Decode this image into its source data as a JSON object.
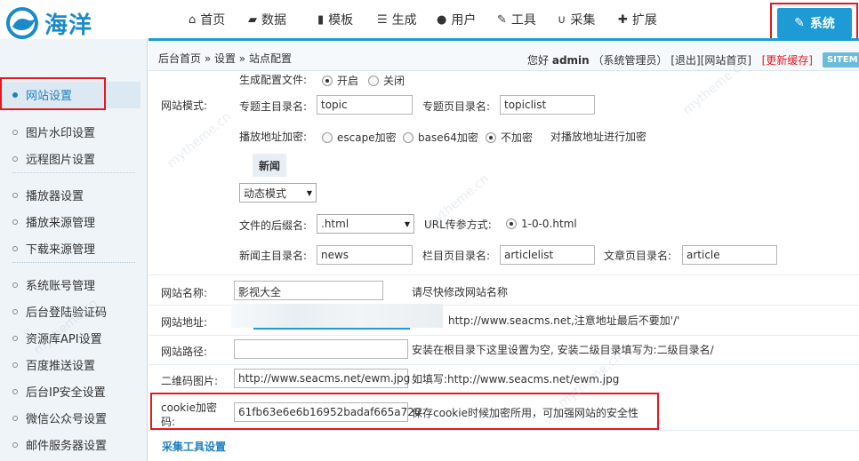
{
  "brand": {
    "name": "海洋"
  },
  "nav": {
    "items": [
      {
        "label": "首页",
        "icon": "home-icon",
        "glyph": "⌂"
      },
      {
        "label": "数据",
        "icon": "book-icon",
        "glyph": "▰"
      },
      {
        "label": "模板",
        "icon": "template-icon",
        "glyph": "▮"
      },
      {
        "label": "生成",
        "icon": "tasks-icon",
        "glyph": "☰"
      },
      {
        "label": "用户",
        "icon": "user-icon",
        "glyph": "●"
      },
      {
        "label": "工具",
        "icon": "wrench-icon",
        "glyph": "✎"
      },
      {
        "label": "采集",
        "icon": "magnet-icon",
        "glyph": "∪"
      },
      {
        "label": "扩展",
        "icon": "puzzle-icon",
        "glyph": "✚"
      }
    ],
    "active": {
      "label": "系统",
      "icon": "edit-icon",
      "glyph": "✎"
    }
  },
  "sidebar": {
    "items": [
      {
        "label": "网站设置",
        "active": true
      },
      {
        "label": "图片水印设置"
      },
      {
        "label": "远程图片设置"
      },
      {
        "label": "播放器设置"
      },
      {
        "label": "播放来源管理"
      },
      {
        "label": "下载来源管理"
      },
      {
        "label": "系统账号管理"
      },
      {
        "label": "后台登陆验证码"
      },
      {
        "label": "资源库API设置"
      },
      {
        "label": "百度推送设置"
      },
      {
        "label": "后台IP安全设置"
      },
      {
        "label": "微信公众号设置"
      },
      {
        "label": "邮件服务器设置"
      }
    ]
  },
  "breadcrumb": {
    "text": "后台首页 » 设置 » 站点配置"
  },
  "userbar": {
    "greeting": "您好",
    "username": "admin",
    "role": "（系统管理员）",
    "logout": "[退出]",
    "site_home": "[网站首页]",
    "refresh_cache": "[更新缓存]",
    "sitemap": "SITEM"
  },
  "form": {
    "gen_config_label": "生成配置文件:",
    "gen_config_on": "开启",
    "gen_config_off": "关闭",
    "site_mode_label": "网站模式:",
    "topic_dir_label": "专题主目录名:",
    "topic_dir_value": "topic",
    "topic_page_label": "专题页目录名:",
    "topic_page_value": "topiclist",
    "play_encrypt_label": "播放地址加密:",
    "play_encrypt_options": [
      "escape加密",
      "base64加密",
      "不加密"
    ],
    "play_encrypt_hint": "对播放地址进行加密",
    "news_label": "新闻",
    "mode_select": "动态模式",
    "suffix_label": "文件的后缀名:",
    "suffix_value": ".html",
    "url_param_label": "URL传参方式:",
    "url_param_value": "1-0-0.html",
    "news_dir_label": "新闻主目录名:",
    "news_dir_value": "news",
    "column_dir_label": "栏目页目录名:",
    "column_dir_value": "articlelist",
    "article_dir_label": "文章页目录名:",
    "article_dir_value": "article",
    "site_name_label": "网站名称:",
    "site_name_value": "影视大全",
    "site_name_hint": "请尽快修改网站名称",
    "site_url_label": "网站地址:",
    "site_url_hint": "http://www.seacms.net,注意地址最后不要加'/'",
    "site_path_label": "网站路径:",
    "site_path_value": "",
    "site_path_hint": "安装在根目录下这里设置为空, 安装二级目录填写为:二级目录名/",
    "qrcode_label": "二维码图片:",
    "qrcode_value": "http://www.seacms.net/ewm.jpg",
    "qrcode_hint": "如填写:http://www.seacms.net/ewm.jpg",
    "cookie_label_1": "cookie加密",
    "cookie_label_2": "码:",
    "cookie_value": "61fb63e6e6b16952badaf665a720",
    "cookie_hint": "保存cookie时候加密所用，可加强网站的安全性",
    "collect_section": "采集工具设置"
  },
  "colors": {
    "accent": "#1e9bd4",
    "highlight": "#e4181f"
  }
}
